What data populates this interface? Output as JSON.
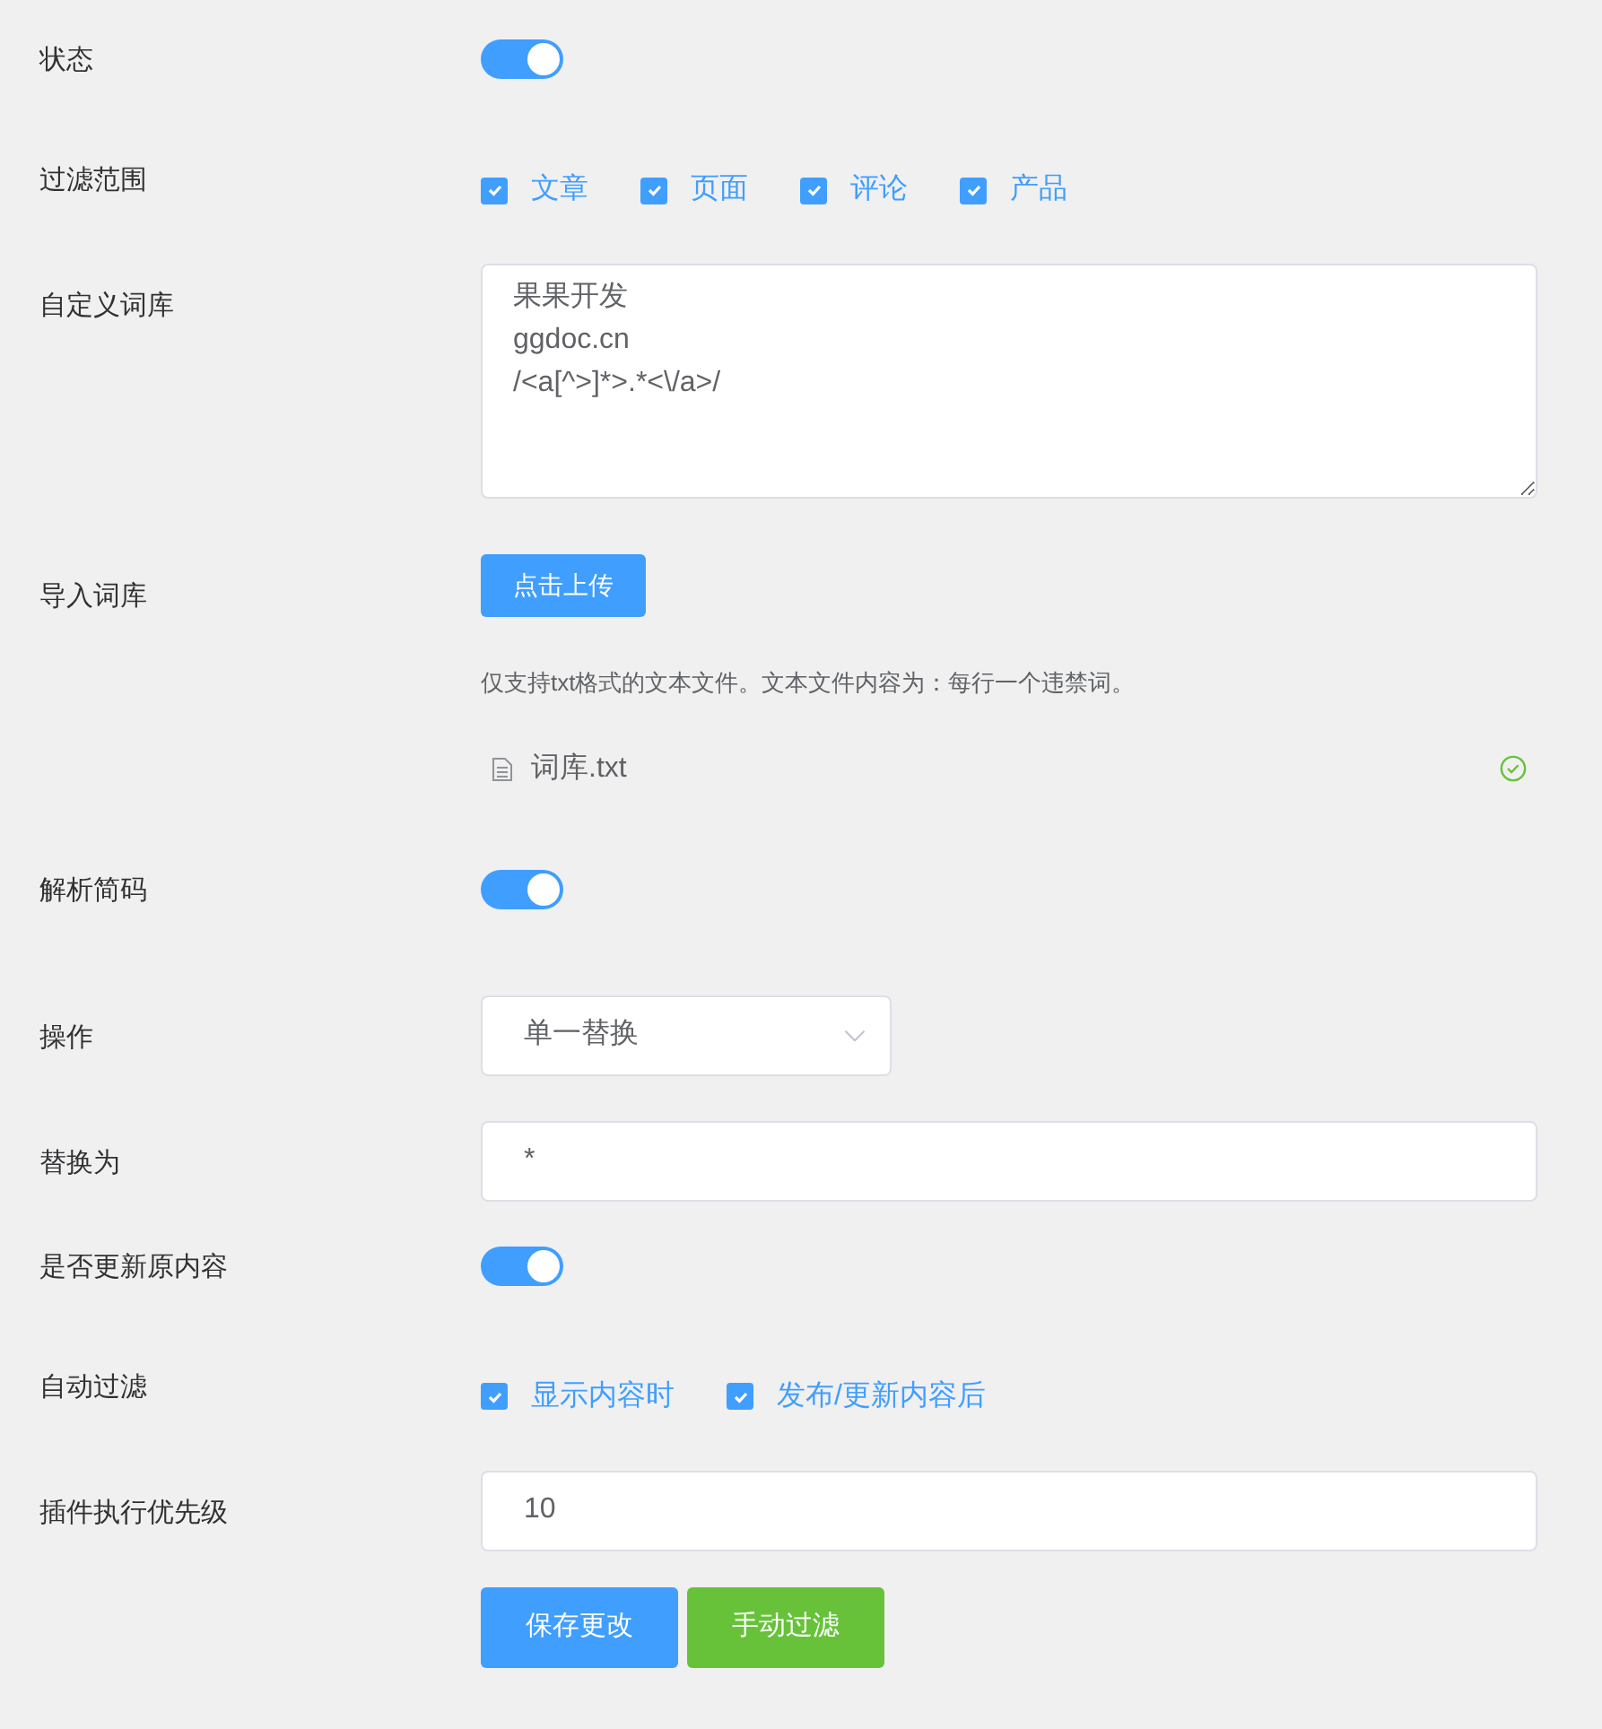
{
  "rows": [
    {
      "kind": "switch",
      "label": "状态",
      "on": true
    },
    {
      "kind": "checkboxes",
      "label": "过滤范围",
      "options": [
        {
          "label": "文章",
          "checked": true
        },
        {
          "label": "页面",
          "checked": true
        },
        {
          "label": "评论",
          "checked": true
        },
        {
          "label": "产品",
          "checked": true
        }
      ]
    },
    {
      "kind": "textarea",
      "label": "自定义词库",
      "value": "果果开发\nggdoc.cn\n/<a[^>]*>.*<\\/a>/"
    },
    {
      "kind": "upload",
      "label": "导入词库",
      "button": "点击上传",
      "hint": "仅支持txt格式的文本文件。文本文件内容为：每行一个违禁词。",
      "file": {
        "name": "词库.txt",
        "done": true
      }
    },
    {
      "kind": "switch",
      "label": "解析简码",
      "on": true
    },
    {
      "kind": "select",
      "label": "操作",
      "value": "单一替换"
    },
    {
      "kind": "input",
      "label": "替换为",
      "value": "*"
    },
    {
      "kind": "switch",
      "label": "是否更新原内容",
      "on": true
    },
    {
      "kind": "checkboxes",
      "label": "自动过滤",
      "options": [
        {
          "label": "显示内容时",
          "checked": true
        },
        {
          "label": "发布/更新内容后",
          "checked": true
        }
      ]
    },
    {
      "kind": "input",
      "label": "插件执行优先级",
      "value": "10"
    }
  ],
  "buttons": [
    {
      "label": "保存更改",
      "kind": "primary"
    },
    {
      "label": "手动过滤",
      "kind": "success"
    }
  ]
}
